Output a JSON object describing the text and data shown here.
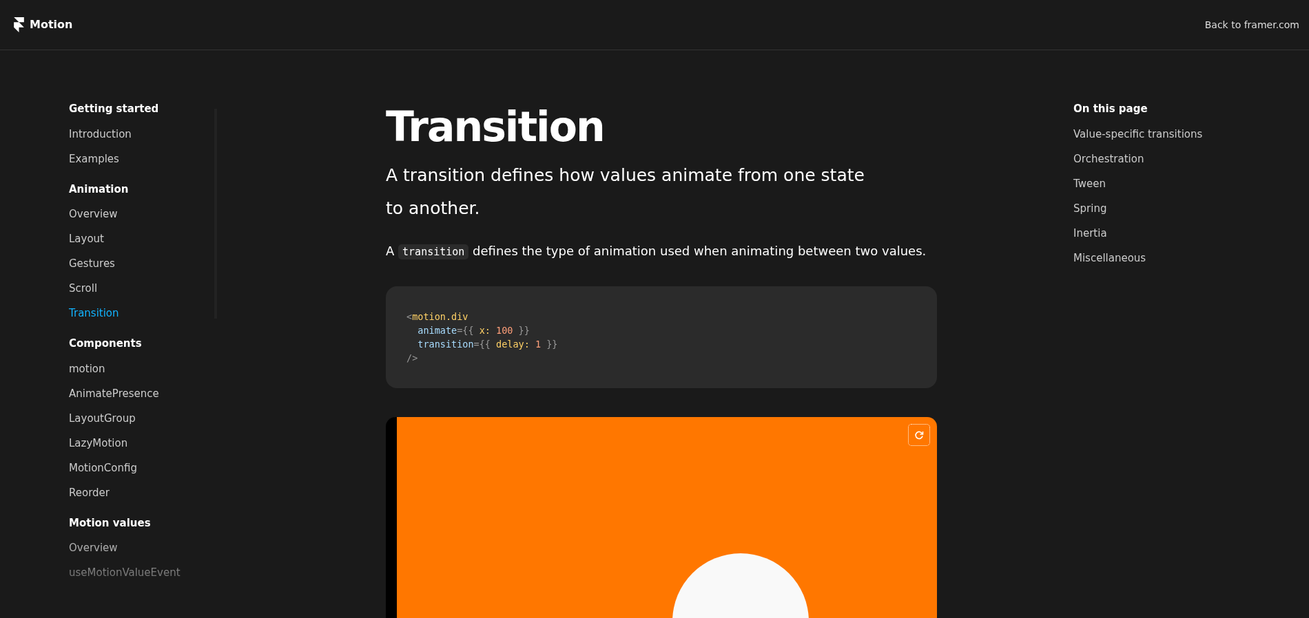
{
  "header": {
    "brand": "Motion",
    "link": "Back to framer.com"
  },
  "sidebar": {
    "sections": [
      {
        "title": "Getting started",
        "items": [
          {
            "label": "Introduction",
            "selected": false
          },
          {
            "label": "Examples",
            "selected": false
          }
        ]
      },
      {
        "title": "Animation",
        "items": [
          {
            "label": "Overview",
            "selected": false
          },
          {
            "label": "Layout",
            "selected": false
          },
          {
            "label": "Gestures",
            "selected": false
          },
          {
            "label": "Scroll",
            "selected": false
          },
          {
            "label": "Transition",
            "selected": true
          }
        ]
      },
      {
        "title": "Components",
        "items": [
          {
            "label": "motion",
            "selected": false
          },
          {
            "label": "AnimatePresence",
            "selected": false
          },
          {
            "label": "LayoutGroup",
            "selected": false
          },
          {
            "label": "LazyMotion",
            "selected": false
          },
          {
            "label": "MotionConfig",
            "selected": false
          },
          {
            "label": "Reorder",
            "selected": false
          }
        ]
      },
      {
        "title": "Motion values",
        "items": [
          {
            "label": "Overview",
            "selected": false
          },
          {
            "label": "useMotionValueEvent",
            "selected": false
          }
        ]
      }
    ]
  },
  "article": {
    "title": "Transition",
    "lead": "A transition defines how values animate from one state to another.",
    "paragraph": [
      {
        "kind": "text",
        "text": "A "
      },
      {
        "kind": "code",
        "text": "transition"
      },
      {
        "kind": "text",
        "text": " defines the type of animation used when animating between two values."
      }
    ],
    "code_block": [
      [
        {
          "kind": "punct",
          "text": "<"
        },
        {
          "kind": "tag",
          "text": "motion.div"
        }
      ],
      [
        {
          "kind": "attr",
          "text": "  animate"
        },
        {
          "kind": "punct",
          "text": "={{ "
        },
        {
          "kind": "key",
          "text": "x: "
        },
        {
          "kind": "number",
          "text": "100"
        },
        {
          "kind": "punct",
          "text": " }}"
        }
      ],
      [
        {
          "kind": "attr",
          "text": "  transition"
        },
        {
          "kind": "punct",
          "text": "={{ "
        },
        {
          "kind": "key",
          "text": "delay: "
        },
        {
          "kind": "number",
          "text": "1"
        },
        {
          "kind": "punct",
          "text": " }}"
        }
      ],
      [
        {
          "kind": "punct",
          "text": "/>"
        }
      ]
    ]
  },
  "toc": {
    "title": "On this page",
    "items": [
      "Value-specific transitions",
      "Orchestration",
      "Tween",
      "Spring",
      "Inertia",
      "Miscellaneous"
    ]
  }
}
